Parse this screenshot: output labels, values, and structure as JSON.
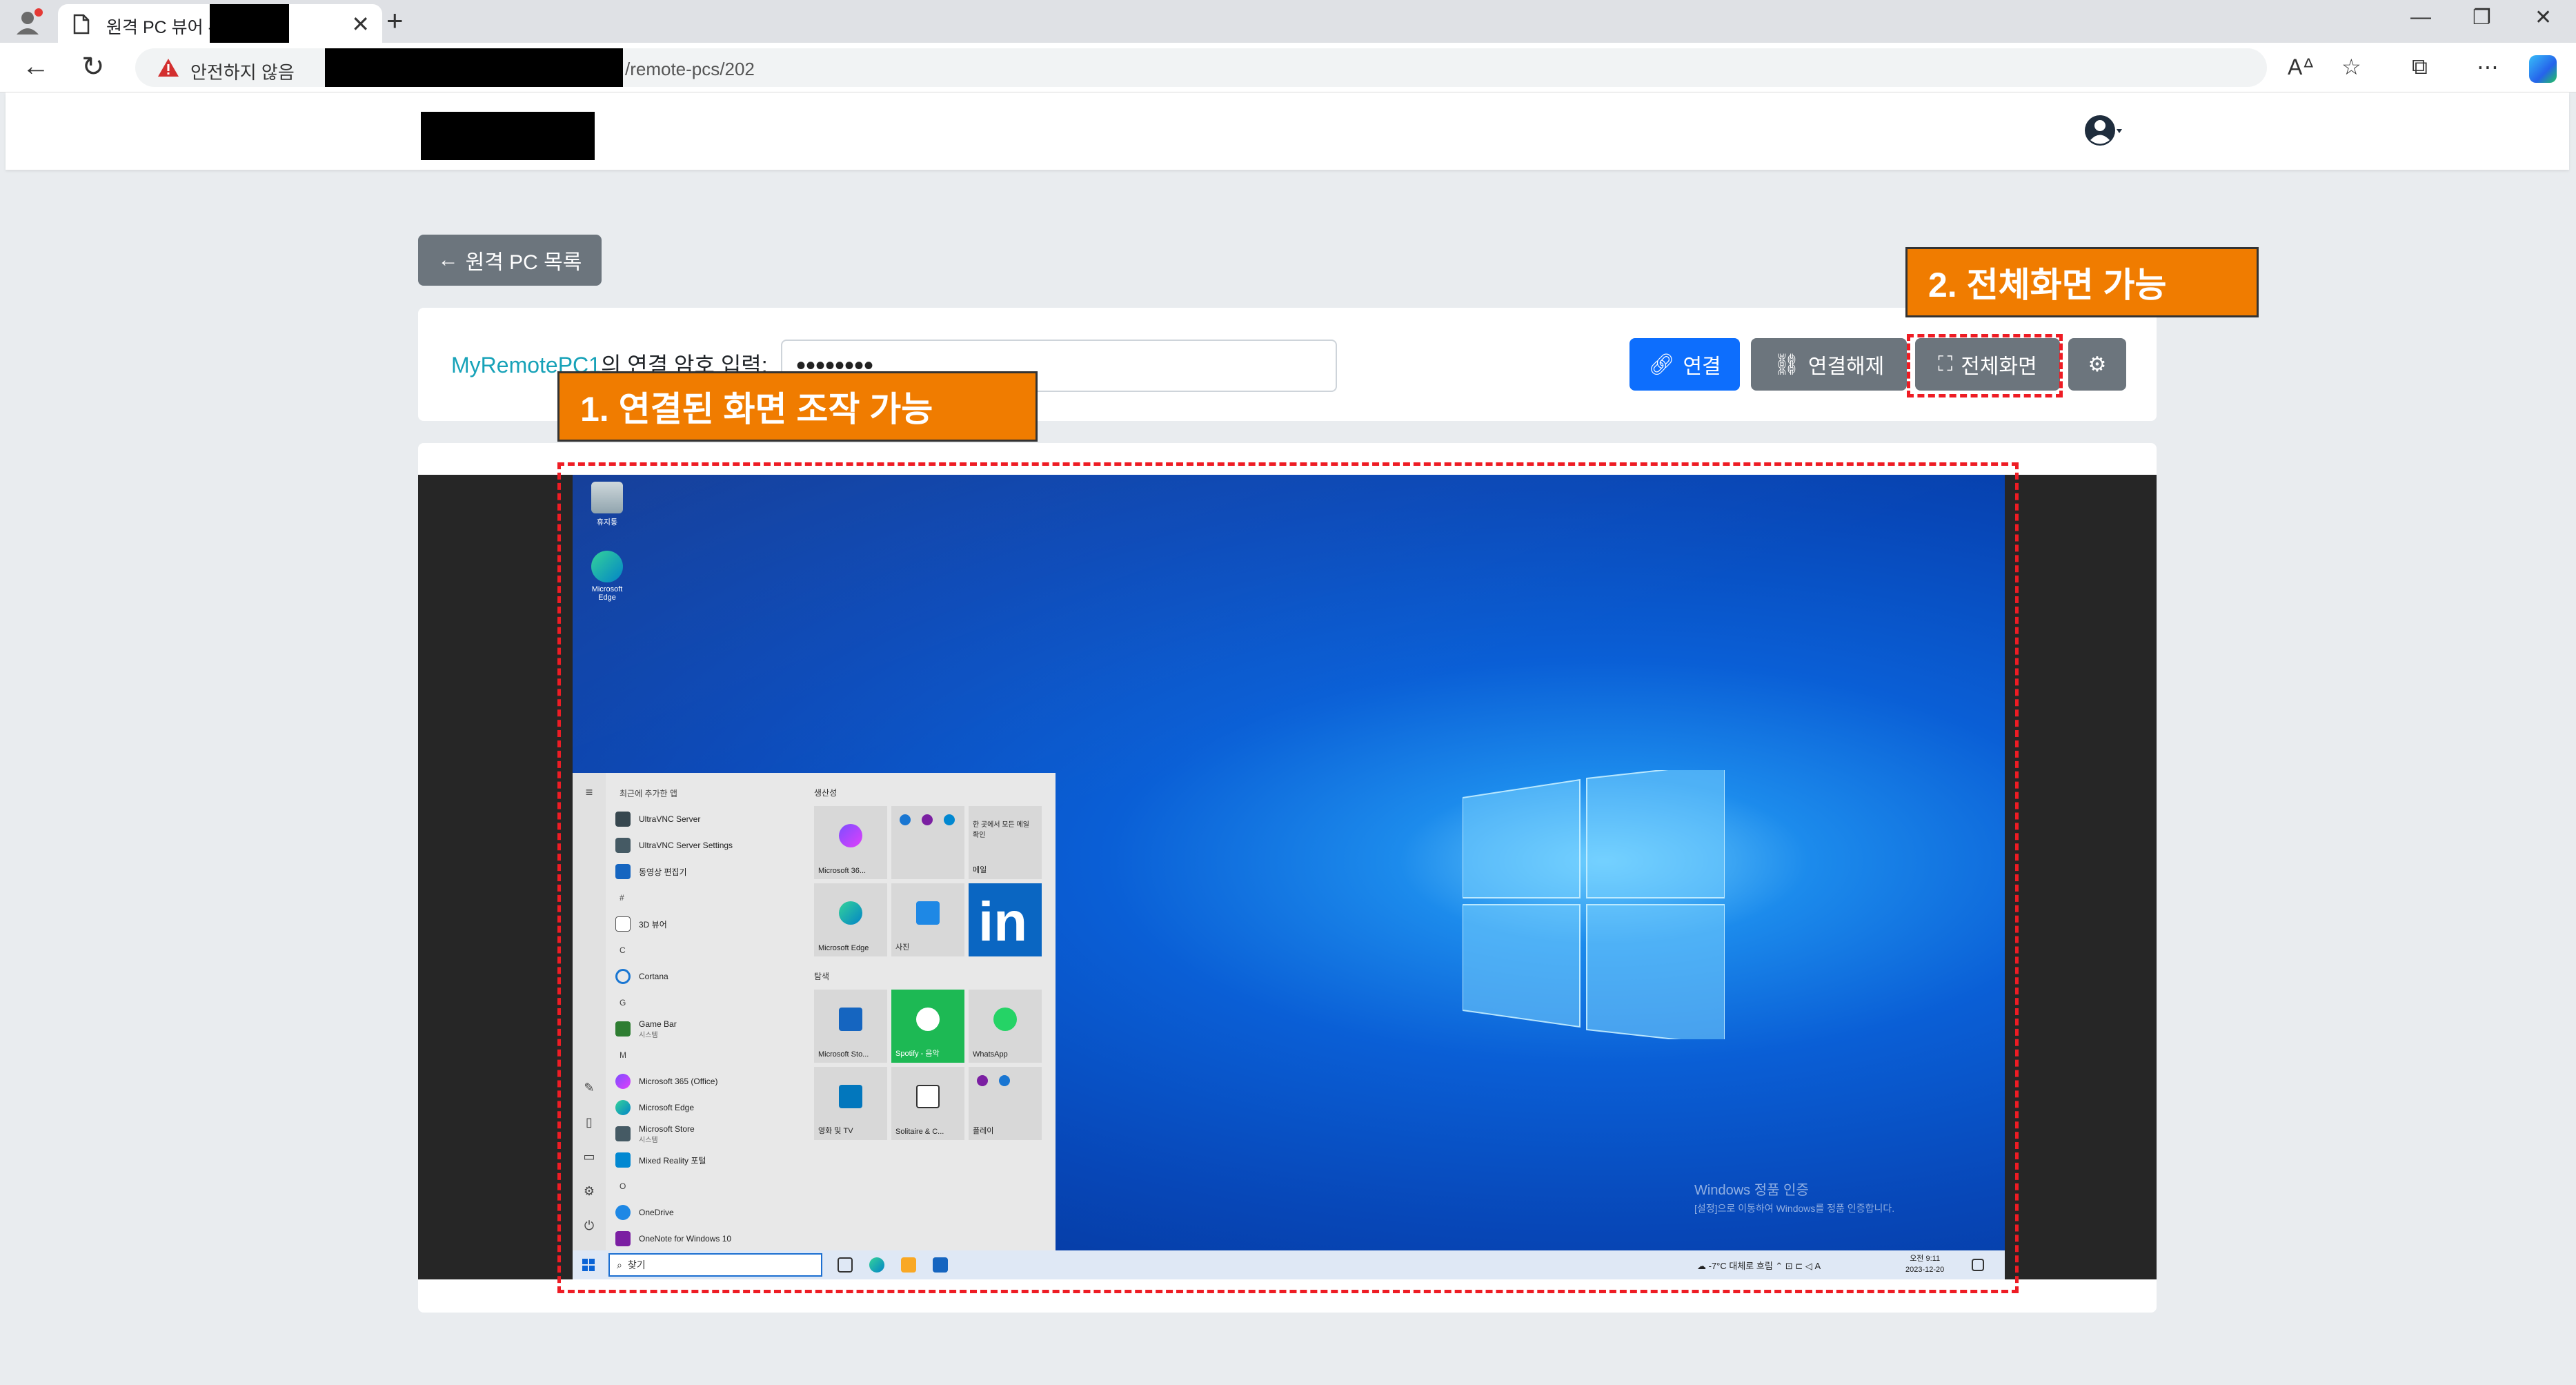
{
  "browser": {
    "tab_title": "원격 PC 뷰어 -",
    "new_tab": "+",
    "url_warning": "안전하지 않음",
    "url_path": "/remote-pcs/202"
  },
  "page": {
    "back_button": "원격 PC 목록",
    "pc_name": "MyRemotePC1",
    "password_label_suffix": "의 연결 암호 입력:",
    "password_value": "••••••••",
    "connect_button": "연결",
    "disconnect_button": "연결해제",
    "fullscreen_button": "전체화면"
  },
  "annotations": {
    "callout1": "1. 연결된 화면 조작 가능",
    "callout2": "2. 전체화면 가능",
    "box_color": "#ee1c24",
    "callout_color": "#f07c00"
  },
  "remote": {
    "desktop_icons": [
      "휴지통",
      "Microsoft Edge"
    ],
    "watermark_title": "Windows 정품 인증",
    "watermark_sub": "[설정]으로 이동하여 Windows를 정품 인증합니다.",
    "start_menu": {
      "recent_header": "최근에 추가한 앱",
      "productivity_header": "생산성",
      "explore_header": "탐색",
      "apps": [
        {
          "label": "UltraVNC Server",
          "sub": ""
        },
        {
          "label": "UltraVNC Server Settings",
          "sub": ""
        },
        {
          "label": "동영상 편집기",
          "sub": ""
        },
        {
          "letter": "#"
        },
        {
          "label": "3D 뷰어",
          "sub": ""
        },
        {
          "letter": "C"
        },
        {
          "label": "Cortana",
          "sub": ""
        },
        {
          "letter": "G"
        },
        {
          "label": "Game Bar",
          "sub": "시스템"
        },
        {
          "letter": "M"
        },
        {
          "label": "Microsoft 365 (Office)",
          "sub": ""
        },
        {
          "label": "Microsoft Edge",
          "sub": ""
        },
        {
          "label": "Microsoft Store",
          "sub": "시스템"
        },
        {
          "label": "Mixed Reality 포털",
          "sub": ""
        },
        {
          "letter": "O"
        },
        {
          "label": "OneDrive",
          "sub": ""
        },
        {
          "label": "OneNote for Windows 10",
          "sub": ""
        }
      ],
      "tiles": {
        "microsoft365": "Microsoft 36...",
        "mail_caption": "한 곳에서 모든 메일 확인",
        "mail": "메일",
        "edge": "Microsoft Edge",
        "photos": "사진",
        "store": "Microsoft Sto...",
        "spotify": "Spotify - 음악",
        "whatsapp": "WhatsApp",
        "movies": "영화 및 TV",
        "solitaire": "Solitaire & C...",
        "play": "플레이"
      }
    },
    "taskbar": {
      "search_placeholder": "찾기",
      "tray_text": "☁ -7°C  대체로 흐림   ⌃ ⊡ ⊏ ◁ A",
      "time": "오전 9:11",
      "date": "2023-12-20"
    }
  }
}
